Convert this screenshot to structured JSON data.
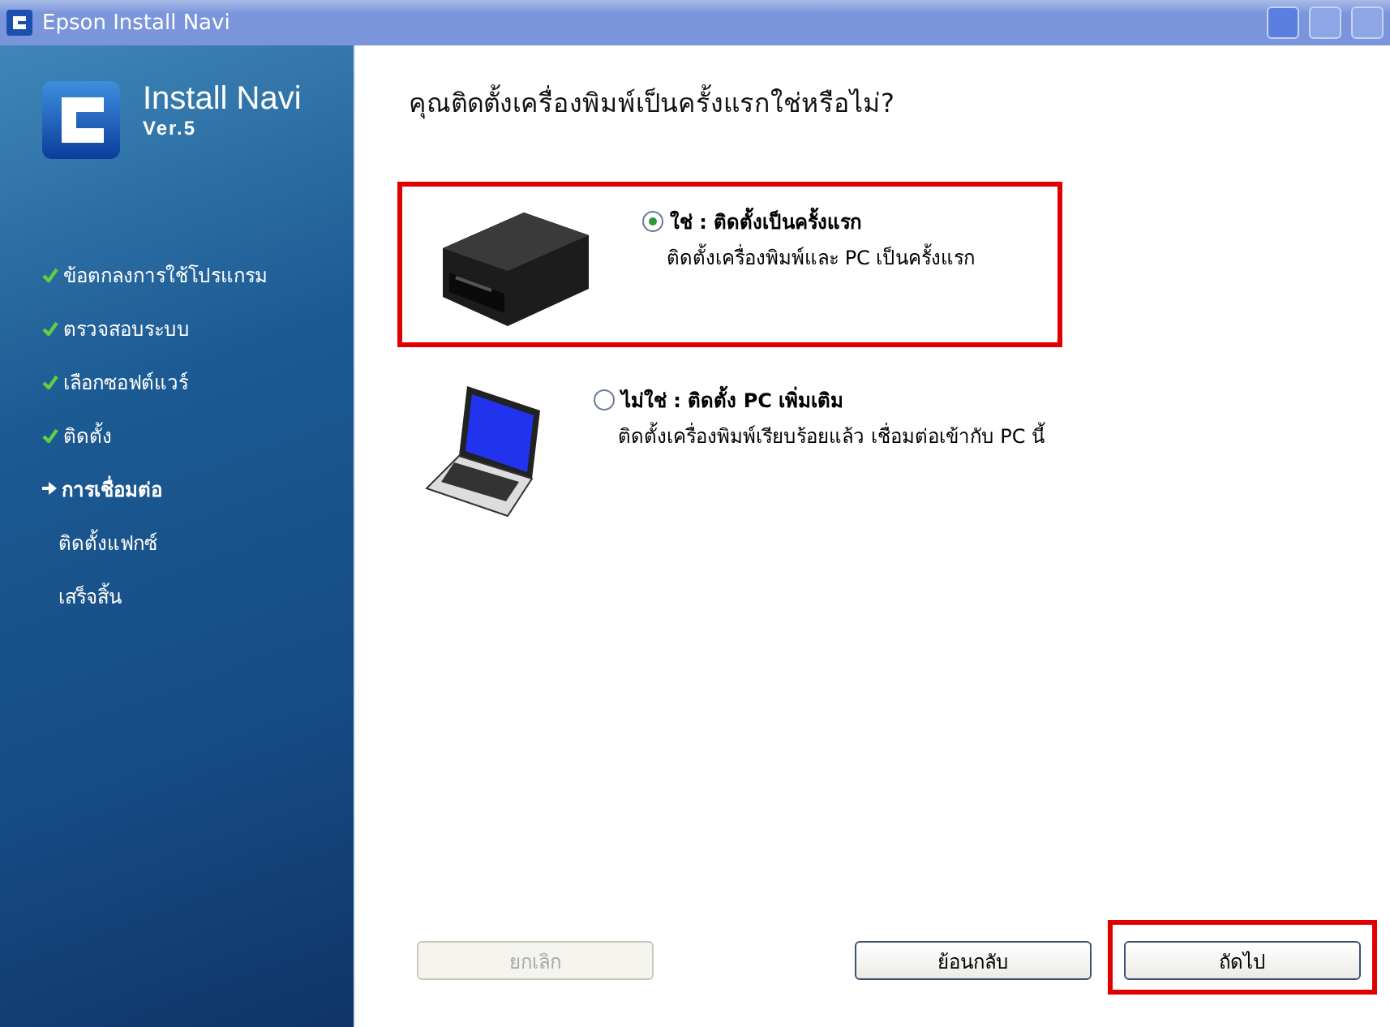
{
  "window": {
    "title": "Epson Install Navi"
  },
  "sidebar": {
    "app_name": "Install Navi",
    "version": "Ver.5",
    "steps": [
      {
        "label": "ข้อตกลงการใช้โปรแกรม",
        "done": true,
        "selected": false
      },
      {
        "label": "ตรวจสอบระบบ",
        "done": true,
        "selected": false
      },
      {
        "label": "เลือกซอฟต์แวร์",
        "done": true,
        "selected": false
      },
      {
        "label": "ติดตั้ง",
        "done": true,
        "selected": false
      },
      {
        "label": "การเชื่อมต่อ",
        "done": false,
        "selected": true
      },
      {
        "label": "ติดตั้งแฟกซ์",
        "done": false,
        "selected": false
      },
      {
        "label": "เสร็จสิ้น",
        "done": false,
        "selected": false
      }
    ]
  },
  "heading": "คุณติดตั้งเครื่องพิมพ์เป็นครั้งแรกใช่หรือไม่?",
  "options": [
    {
      "kind": "printer",
      "title": "ใช่ : ติดตั้งเป็นครั้งแรก",
      "description": "ติดตั้งเครื่องพิมพ์และ PC เป็นครั้งแรก",
      "selected": true,
      "highlighted": true
    },
    {
      "kind": "laptop",
      "title": "ไม่ใช่ : ติดตั้ง PC เพิ่มเติม",
      "description": "ติดตั้งเครื่องพิมพ์เรียบร้อยแล้ว เชื่อมต่อเข้ากับ PC นี้",
      "selected": false,
      "highlighted": false
    }
  ],
  "buttons": [
    {
      "label": "ยกเลิก",
      "disabled": true,
      "highlighted": false
    },
    {
      "label": "ย้อนกลับ",
      "disabled": false,
      "highlighted": false
    },
    {
      "label": "ถัดไป",
      "disabled": false,
      "highlighted": true
    }
  ]
}
